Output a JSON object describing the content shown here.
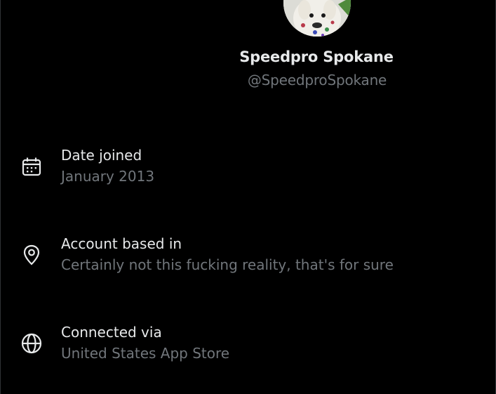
{
  "profile": {
    "display_name": "Speedpro Spokane",
    "handle": "@SpeedproSpokane",
    "avatar_alt": "avatar"
  },
  "details": [
    {
      "icon": "calendar-icon",
      "label": "Date joined",
      "value": "January 2013"
    },
    {
      "icon": "location-pin-icon",
      "label": "Account based in",
      "value": "Certainly not this fucking reality, that's for sure"
    },
    {
      "icon": "globe-icon",
      "label": "Connected via",
      "value": "United States App Store"
    }
  ],
  "colors": {
    "background": "#000000",
    "primary_text": "#e7e9ea",
    "secondary_text": "#71767b",
    "border": "#2f3336"
  }
}
